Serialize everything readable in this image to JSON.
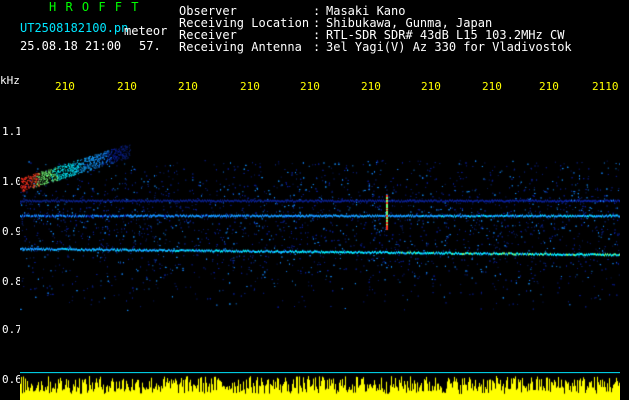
{
  "header": {
    "brand": "H R O F F T",
    "filename": "UT2508182100.pn",
    "mode": "meteor",
    "datetime": "25.08.18 21:00",
    "count": "57.",
    "info_labels": [
      "Observer",
      "Receiving Location",
      "Receiver",
      "Receiving Antenna"
    ],
    "info_colons": [
      ":",
      ":",
      ":",
      ":"
    ],
    "info_values": [
      "Masaki Kano",
      "Shibukawa, Gunma, Japan",
      "RTL-SDR SDR# 43dB L15 103.2MHz CW",
      "3el Yagi(V) Az 330 for Vladivostok"
    ]
  },
  "axes": {
    "y_unit": "kHz",
    "y_ticks": [
      "1.1",
      "1.0",
      "0.9",
      "0.8",
      "0.7",
      "0.6"
    ],
    "x_ticks": [
      "210",
      "210",
      "210",
      "210",
      "210",
      "210",
      "210",
      "210",
      "210",
      "2110"
    ]
  },
  "colors": {
    "background": "#000000",
    "label_text": "#ffffff",
    "time_axis": "#ffff00",
    "brand": "#00ff00",
    "activity_bars": "#ffff00",
    "activity_baseline": "#00e6ff",
    "signal_low": "#0a1e8c",
    "signal_mid": "#00c8ff",
    "signal_high": "#ff2020"
  }
}
